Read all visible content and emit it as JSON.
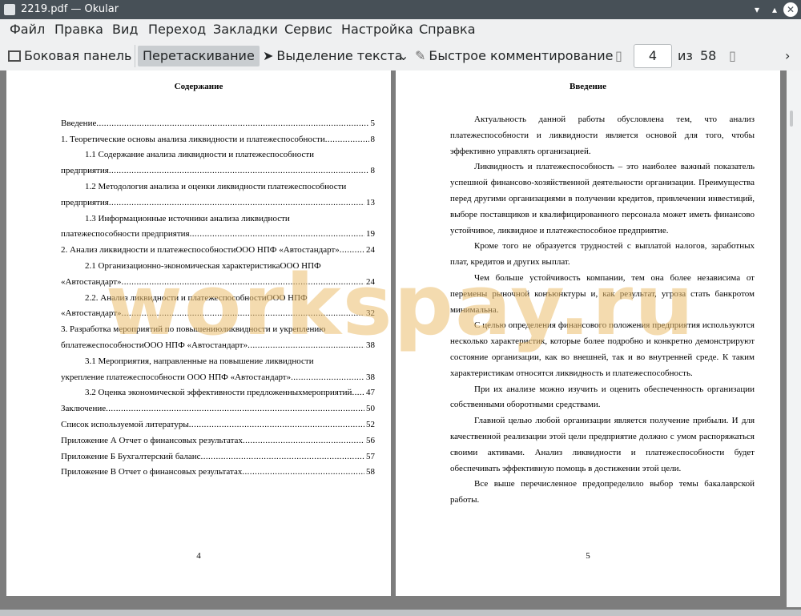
{
  "window": {
    "title": "2219.pdf  — Okular"
  },
  "menu": [
    "Файл",
    "Правка",
    "Вид",
    "Переход",
    "Закладки",
    "Сервис",
    "Настройка",
    "Справка"
  ],
  "toolbar": {
    "sidebar_label": "Боковая панель",
    "drag_label": "Перетаскивание",
    "select_label": "Выделение текста",
    "annotate_label": "Быстрое комментирование",
    "page_current": "4",
    "page_of_label": "из",
    "page_total": "58"
  },
  "left_page": {
    "heading": "Содержание",
    "toc": [
      {
        "text": "Введение",
        "page": "5",
        "indent": false
      },
      {
        "text": "1. Теоретические основы анализа ликвидности и платежеспособности",
        "page": "8",
        "indent": false
      },
      {
        "text": "1.1 Содержание анализа ликвидности и платежеспособности",
        "page": "",
        "indent": true
      },
      {
        "text": "предприятия",
        "page": "8",
        "indent": false
      },
      {
        "text": "1.2 Методология анализа и оценки ликвидности платежеспособности",
        "page": "",
        "indent": true
      },
      {
        "text": "предприятия",
        "page": "13",
        "indent": false
      },
      {
        "text": "1.3 Информационные источники анализа ликвидности",
        "page": "",
        "indent": true
      },
      {
        "text": "платежеспособности предприятия",
        "page": "19",
        "indent": false
      },
      {
        "text": "2.  Анализ ликвидности и платежеспособностиООО НПФ «Автостандарт»",
        "page": "24",
        "indent": false
      },
      {
        "text": "2.1 Организационно-экономическая характеристикаООО НПФ",
        "page": "",
        "indent": true
      },
      {
        "text": "«Автостандарт»",
        "page": "24",
        "indent": false
      },
      {
        "text": "2.2. Анализ ликвидности и платежеспособностиООО НПФ",
        "page": "",
        "indent": true
      },
      {
        "text": "«Автостандарт»",
        "page": "32",
        "indent": false
      },
      {
        "text": "3. Разработка мероприятий по повышениюликвидности и укреплению",
        "page": "",
        "indent": false
      },
      {
        "text": "бплатежеспособностиООО НПФ «Автостандарт»",
        "page": "38",
        "indent": false
      },
      {
        "text": "3.1 Мероприятия, направленные на повышение ликвидности",
        "page": "",
        "indent": true
      },
      {
        "text": "укрепление платежеспособности ООО НПФ «Автостандарт»",
        "page": "38",
        "indent": false
      },
      {
        "text": "3.2 Оценка экономической эффективности предложенныхмероприятий",
        "page": "47",
        "indent": true
      },
      {
        "text": "Заключение",
        "page": "50",
        "indent": false
      },
      {
        "text": "Список используемой литературы",
        "page": "52",
        "indent": false
      },
      {
        "text": "Приложение А Отчет о финансовых результатах",
        "page": "56",
        "indent": false
      },
      {
        "text": "Приложение Б Бухгалтерский баланс",
        "page": "57",
        "indent": false
      },
      {
        "text": "Приложение В Отчет о финансовых результатах",
        "page": "58",
        "indent": false
      }
    ],
    "page_number": "4"
  },
  "right_page": {
    "heading": "Введение",
    "paragraphs": [
      "Актуальность данной работы обусловлена тем, что анализ платежеспособности и ликвидности является основой для того, чтобы эффективно управлять организацией.",
      "Ликвидность и платежеспособность – это наиболее важный показатель успешной финансово-хозяйственной деятельности организации. Преимущества перед другими организациями в получении кредитов, привлечении инвестиций, выборе поставщиков и квалифицированного персонала может иметь финансово устойчивое, ликвидное и платежеспособное предприятие.",
      "Кроме того не образуется трудностей с выплатой налогов, заработных плат, кредитов и других выплат.",
      "Чем больше устойчивость компании, тем она более независима от перемены рыночной конъюнктуры и, как результат, угроза стать банкротом минимальна.",
      "С целью определения финансового положения предприятия используются несколько характеристик, которые более подробно и конкретно демонстрируют состояние организации, как во внешней, так и во внутренней среде. К таким характеристикам относятся ликвидность и платежеспособность.",
      "При их анализе можно изучить и оценить обеспеченность организации собственными оборотными средствами.",
      "Главной целью любой организации является получение прибыли. И для качественной реализации этой цели предприятие должно с умом распоряжаться своими активами. Анализ ликвидности и платежеспособности будет обеспечивать эффективную помощь в достижении этой цели.",
      "Все выше перечисленное предопределило выбор темы бакалаврской работы."
    ],
    "page_number": "5"
  },
  "watermark": "workspay.ru"
}
